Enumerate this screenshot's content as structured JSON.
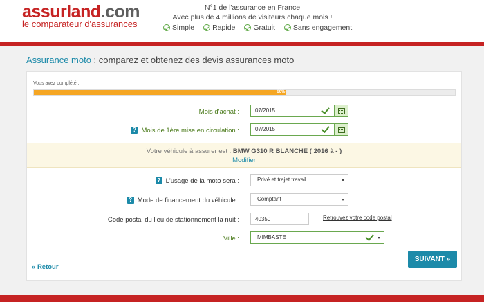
{
  "header": {
    "logo_part1": "assur",
    "logo_part2": "land",
    "logo_part3": ".com",
    "logo_sub": "le comparateur d'assurances",
    "tagline_line1": "N°1 de l'assurance en France",
    "tagline_line2": "Avec plus de 4 millions de visiteurs chaque mois !",
    "badges": [
      "Simple",
      "Rapide",
      "Gratuit",
      "Sans engagement"
    ]
  },
  "page": {
    "title_accent": "Assurance moto",
    "title_rest": " : comparez et obtenez des devis assurances moto"
  },
  "progress": {
    "label": "Vous avez complété :",
    "percent": 60,
    "percent_text": "60%"
  },
  "form": {
    "purchase_month": {
      "label": "Mois d'achat :",
      "value": "07/2015"
    },
    "first_registration": {
      "label": "Mois de 1ère mise en circulation :",
      "value": "07/2015"
    },
    "vehicle": {
      "prefix": "Votre véhicule à assurer est : ",
      "model": "BMW G310 R BLANCHE ( 2016 à - )",
      "modify_label": "Modifier"
    },
    "usage": {
      "label": "L'usage de la moto sera :",
      "value": "Privé et trajet travail"
    },
    "financing": {
      "label": "Mode de financement du véhicule :",
      "value": "Comptant"
    },
    "postal_code": {
      "label": "Code postal du lieu de stationnement la nuit :",
      "value": "40350",
      "link": "Retrouvez votre code postal"
    },
    "city": {
      "label": "Ville :",
      "value": "MIMBASTE"
    }
  },
  "nav": {
    "back_label": "Retour",
    "next_label": "SUIVANT »"
  },
  "colors": {
    "brand_red": "#c62323",
    "accent_blue": "#1c8aa9",
    "progress_orange": "#f5a623",
    "valid_green": "#6aa84f"
  }
}
